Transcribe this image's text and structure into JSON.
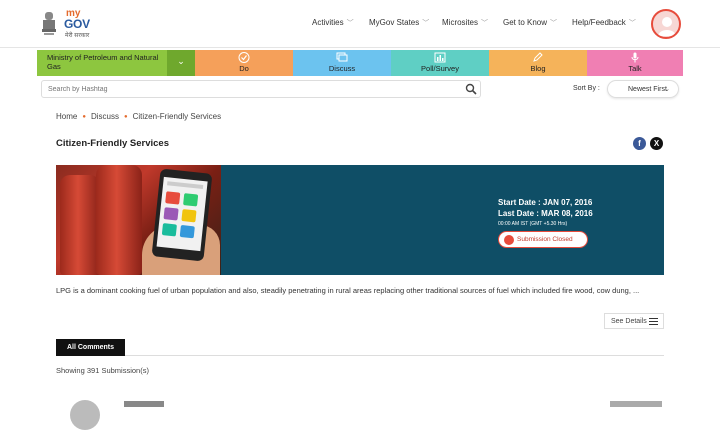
{
  "header": {
    "logo_my": "my",
    "logo_gov": "GOV",
    "logo_hindi": "मेरी सरकार",
    "nav": [
      {
        "label": "Activities"
      },
      {
        "label": "MyGov States"
      },
      {
        "label": "Microsites"
      },
      {
        "label": "Get to Know"
      },
      {
        "label": "Help/Feedback"
      }
    ]
  },
  "tiles": {
    "ministry": "Ministry of Petroleum and Natural Gas",
    "items": [
      {
        "label": "Do",
        "color": "#f5a05a"
      },
      {
        "label": "Discuss",
        "color": "#6cc3ef"
      },
      {
        "label": "Poll/Survey",
        "color": "#5fcfc4"
      },
      {
        "label": "Blog",
        "color": "#f5b35a"
      },
      {
        "label": "Talk",
        "color": "#f07fb3"
      }
    ]
  },
  "search": {
    "placeholder": "Search by Hashtag"
  },
  "sort": {
    "label": "Sort By :",
    "selected": "Newest First"
  },
  "breadcrumb": {
    "home": "Home",
    "discuss": "Discuss",
    "current": "Citizen-Friendly Services"
  },
  "page": {
    "title": "Citizen-Friendly Services",
    "start": "Start Date :  JAN 07, 2016",
    "last": "Last Date :  MAR 08, 2016",
    "deadline_note": "00:00 AM IST (GMT +5.30 Hrs)",
    "status": "Submission Closed",
    "description": "LPG is a dominant cooking fuel of urban population and also, steadily penetrating in rural areas replacing other traditional sources of fuel which included fire wood, cow dung, ...",
    "see_details": "See Details"
  },
  "comments": {
    "tab": "All Comments",
    "showing": "Showing 391 Submission(s)"
  },
  "share": {
    "facebook": "f",
    "x": "X"
  }
}
